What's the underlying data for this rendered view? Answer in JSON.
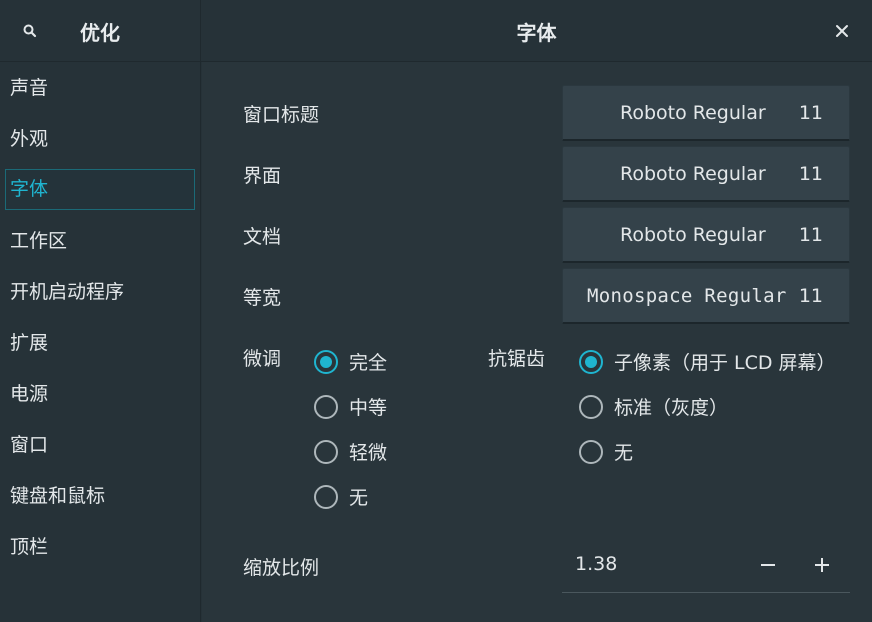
{
  "header": {
    "app_title": "优化",
    "page_title": "字体"
  },
  "sidebar": {
    "items": [
      {
        "label": "声音"
      },
      {
        "label": "外观"
      },
      {
        "label": "字体",
        "active": true
      },
      {
        "label": "工作区"
      },
      {
        "label": "开机启动程序"
      },
      {
        "label": "扩展"
      },
      {
        "label": "电源"
      },
      {
        "label": "窗口"
      },
      {
        "label": "键盘和鼠标"
      },
      {
        "label": "顶栏"
      }
    ]
  },
  "fonts": {
    "window_title": {
      "label": "窗口标题",
      "font": "Roboto Regular",
      "size": "11"
    },
    "interface": {
      "label": "界面",
      "font": "Roboto Regular",
      "size": "11"
    },
    "document": {
      "label": "文档",
      "font": "Roboto Regular",
      "size": "11"
    },
    "monospace": {
      "label": "等宽",
      "font": "Monospace Regular",
      "size": "11"
    }
  },
  "hinting": {
    "label": "微调",
    "options": [
      "完全",
      "中等",
      "轻微",
      "无"
    ],
    "selected": "完全"
  },
  "antialiasing": {
    "label": "抗锯齿",
    "options": [
      "子像素（用于 LCD 屏幕）",
      "标准（灰度）",
      "无"
    ],
    "selected": "子像素（用于 LCD 屏幕）"
  },
  "scaling": {
    "label": "缩放比例",
    "value": "1.38"
  },
  "colors": {
    "accent": "#1fb5d0",
    "background": "#263238",
    "panel": "#29353b",
    "button": "#34424a"
  },
  "icons": {
    "search": "search-icon",
    "close": "close-icon",
    "minus": "minus-icon",
    "plus": "plus-icon"
  }
}
